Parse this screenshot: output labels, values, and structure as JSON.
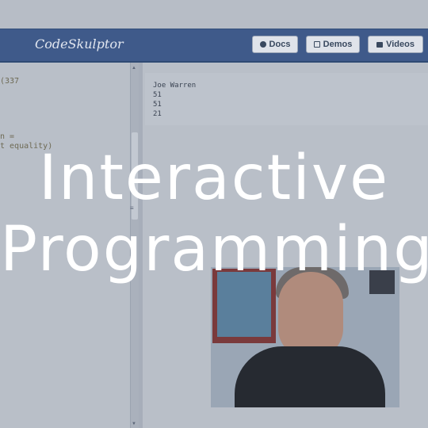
{
  "app": {
    "brand": "CodeSkulptor"
  },
  "nav": {
    "buttons": [
      {
        "label": "Docs",
        "icon": "info-icon"
      },
      {
        "label": "Demos",
        "icon": "demos-icon"
      },
      {
        "label": "Videos",
        "icon": "video-icon"
      }
    ]
  },
  "editor": {
    "lines": [
      "(337",
      "n =",
      "t equality)"
    ]
  },
  "output": {
    "lines": [
      "Joe Warren",
      "51",
      "51",
      "21"
    ]
  },
  "overlay": {
    "line1": "Interactive",
    "line2": "Programming"
  },
  "colors": {
    "navbar": "#3f5a8a",
    "overlay_tint": "#b9bfc8",
    "overlay_text": "#ffffff"
  }
}
